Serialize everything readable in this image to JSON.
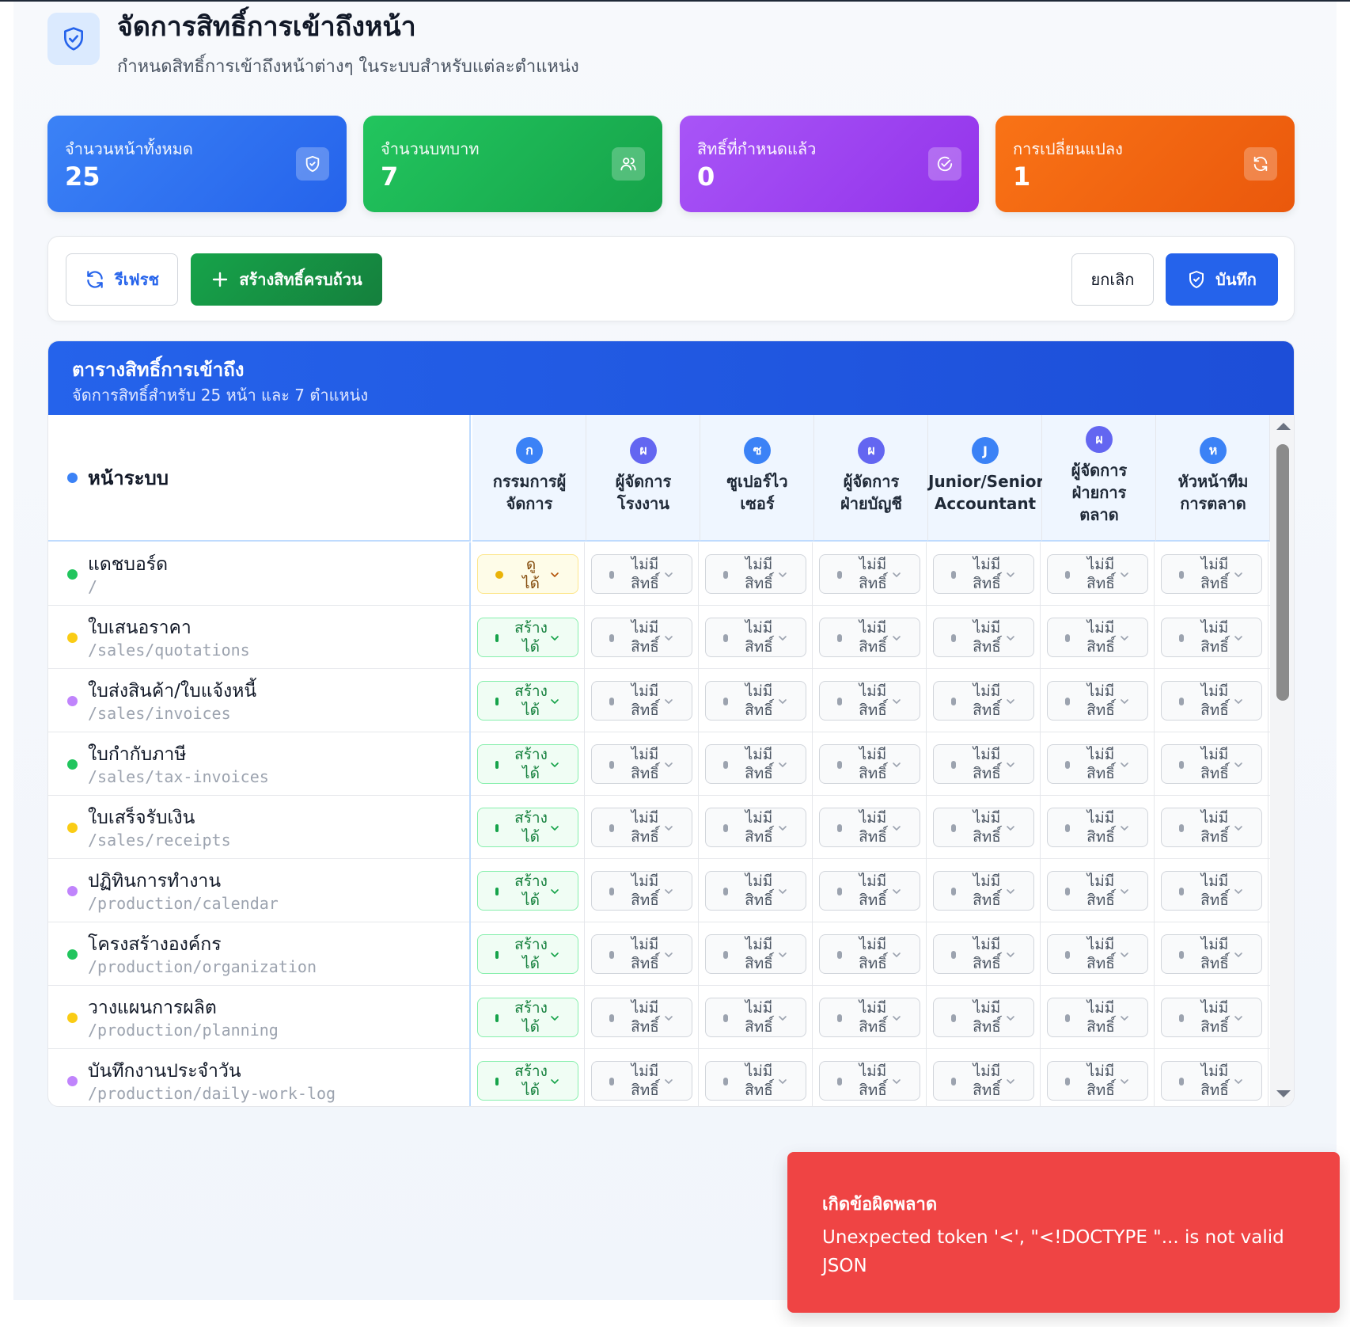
{
  "header": {
    "title": "จัดการสิทธิ์การเข้าถึงหน้า",
    "subtitle": "กำหนดสิทธิ์การเข้าถึงหน้าต่างๆ ในระบบสำหรับแต่ละตำแหน่ง",
    "icon": "shield-check-icon"
  },
  "stats": [
    {
      "label": "จำนวนหน้าทั้งหมด",
      "value": "25",
      "icon": "shield-icon",
      "color": "#3b82f6"
    },
    {
      "label": "จำนวนบทบาท",
      "value": "7",
      "icon": "users-icon",
      "color": "#22c55e"
    },
    {
      "label": "สิทธิ์ที่กำหนดแล้ว",
      "value": "0",
      "icon": "check-circle-icon",
      "color": "#a855f7"
    },
    {
      "label": "การเปลี่ยนแปลง",
      "value": "1",
      "icon": "refresh-icon",
      "color": "#f97316"
    }
  ],
  "toolbar": {
    "refresh_label": "รีเฟรช",
    "create_label": "สร้างสิทธิ์ครบถ้วน",
    "cancel_label": "ยกเลิก",
    "save_label": "บันทึก"
  },
  "table": {
    "title": "ตารางสิทธิ์การเข้าถึง",
    "subtitle": "จัดการสิทธิ์สำหรับ 25 หน้า และ 7 ตำแหน่ง",
    "page_header": "หน้าระบบ",
    "roles": [
      {
        "initial": "ก",
        "name_lines": [
          "กรรมการผู้",
          "จัดการ"
        ],
        "color": "#3b82f6"
      },
      {
        "initial": "ผ",
        "name_lines": [
          "ผู้จัดการ",
          "โรงงาน"
        ],
        "color": "#6366f1"
      },
      {
        "initial": "ซ",
        "name_lines": [
          "ซูเปอร์ไว",
          "เซอร์"
        ],
        "color": "#3b82f6"
      },
      {
        "initial": "ผ",
        "name_lines": [
          "ผู้จัดการ",
          "ฝ่ายบัญชี"
        ],
        "color": "#6366f1"
      },
      {
        "initial": "J",
        "name_lines": [
          "Junior/Senior",
          "Accountant"
        ],
        "color": "#3b82f6"
      },
      {
        "initial": "ผ",
        "name_lines": [
          "ผู้จัดการ",
          "ฝ่ายการ",
          "ตลาด"
        ],
        "color": "#6366f1"
      },
      {
        "initial": "ห",
        "name_lines": [
          "หัวหน้าทีม",
          "การตลาด"
        ],
        "color": "#3b82f6"
      }
    ],
    "levels": {
      "none": [
        "ไม่มี",
        "สิทธิ์"
      ],
      "create": [
        "สร้าง",
        "ได้"
      ],
      "view": [
        "ดู",
        "ได้"
      ]
    },
    "rows": [
      {
        "name": "แดชบอร์ด",
        "path": "/",
        "dot": "#22c55e",
        "first": "view"
      },
      {
        "name": "ใบเสนอราคา",
        "path": "/sales/quotations",
        "dot": "#facc15",
        "first": "create"
      },
      {
        "name": "ใบส่งสินค้า/ใบแจ้งหนี้",
        "path": "/sales/invoices",
        "dot": "#c084fc",
        "first": "create"
      },
      {
        "name": "ใบกำกับภาษี",
        "path": "/sales/tax-invoices",
        "dot": "#22c55e",
        "first": "create"
      },
      {
        "name": "ใบเสร็จรับเงิน",
        "path": "/sales/receipts",
        "dot": "#facc15",
        "first": "create"
      },
      {
        "name": "ปฏิทินการทำงาน",
        "path": "/production/calendar",
        "dot": "#c084fc",
        "first": "create"
      },
      {
        "name": "โครงสร้างองค์กร",
        "path": "/production/organization",
        "dot": "#22c55e",
        "first": "create"
      },
      {
        "name": "วางแผนการผลิต",
        "path": "/production/planning",
        "dot": "#facc15",
        "first": "create"
      },
      {
        "name": "บันทึกงานประจำวัน",
        "path": "/production/daily-work-log",
        "dot": "#c084fc",
        "first": "create"
      }
    ]
  },
  "toast": {
    "title": "เกิดข้อผิดพลาด",
    "message": "Unexpected token '<', \"<!DOCTYPE \"... is not valid JSON",
    "color": "#ef4444"
  }
}
